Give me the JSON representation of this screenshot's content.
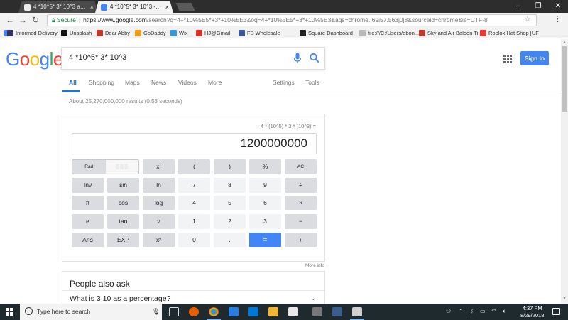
{
  "browser": {
    "tabs": [
      {
        "title": "4 *10^5* 3* 10^3 aASAP",
        "active": false
      },
      {
        "title": "4 *10^5* 3* 10^3 - Goog",
        "active": true
      }
    ],
    "url_secure_label": "Secure",
    "url_host": "https://www.google.com",
    "url_rest": "/search?q=4+*10%5E5*+3*+10%5E3&oq=4+*10%5E5*+3*+10%5E3&aqs=chrome..69i57.563j0j8&sourceid=chrome&ie=UTF-8"
  },
  "bookmarks": [
    {
      "label": "Apps",
      "color": "#4285f4"
    },
    {
      "label": "Informed Delivery",
      "color": "#333366"
    },
    {
      "label": "Unsplash",
      "color": "#111111"
    },
    {
      "label": "Dear Abby",
      "color": "#c0392b"
    },
    {
      "label": "GoDaddy",
      "color": "#f39c12"
    },
    {
      "label": "Wix",
      "color": "#3498db"
    },
    {
      "label": "HJ@Gmail",
      "color": "#d93025"
    },
    {
      "label": "FB Wholesale",
      "color": "#3b5998"
    },
    {
      "label": "Square Dashboard",
      "color": "#222222"
    },
    {
      "label": "file:///C:/Users/ebon...",
      "color": "#888888"
    },
    {
      "label": "Sky and Air Baloon Ti",
      "color": "#c0392b"
    },
    {
      "label": "Roblox Hat Shop [UF",
      "color": "#e53935"
    }
  ],
  "google": {
    "logo": "Google",
    "query": "4 *10^5* 3* 10^3",
    "sign_in": "Sign in",
    "tabs": [
      "All",
      "Shopping",
      "Maps",
      "News",
      "Videos",
      "More",
      "Settings",
      "Tools"
    ],
    "stats": "About 25,270,000,000 results (0.53 seconds)"
  },
  "calculator": {
    "expression": "4 * (10^5) * 3 * (10^3) =",
    "result": "1200000000",
    "rad_label": "Rad",
    "deg_label": "Deg",
    "rows": [
      [
        "x!",
        "(",
        ")",
        "%",
        "AC"
      ],
      [
        "Inv",
        "sin",
        "ln",
        "7",
        "8",
        "9",
        "÷"
      ],
      [
        "π",
        "cos",
        "log",
        "4",
        "5",
        "6",
        "×"
      ],
      [
        "e",
        "tan",
        "√",
        "1",
        "2",
        "3",
        "−"
      ],
      [
        "Ans",
        "EXP",
        "xʸ",
        "0",
        ".",
        "=",
        "+"
      ]
    ],
    "more_info": "More info"
  },
  "people_also_ask": {
    "title": "People also ask",
    "question": "What is 3 10 as a percentage?"
  },
  "taskbar": {
    "search_placeholder": "Type here to search",
    "time": "4:37 PM",
    "date": "8/29/2018"
  },
  "colors": {
    "accent_blue": "#4285f4",
    "google_blue": "#4285F4",
    "google_red": "#EA4335",
    "google_yellow": "#FBBC05",
    "google_green": "#34A853"
  }
}
